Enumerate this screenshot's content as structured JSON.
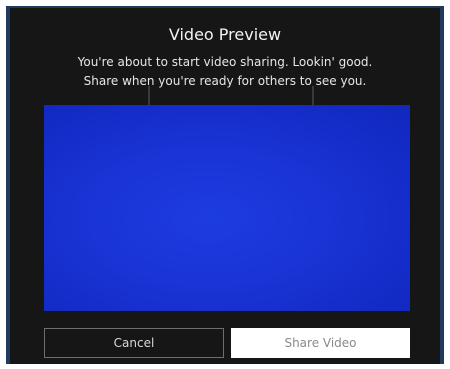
{
  "dialog": {
    "title": "Video Preview",
    "message_line1": "You're about to start video sharing. Lookin' good.",
    "message_line2": "Share when you're ready for others to see you."
  },
  "preview": {
    "feed_color": "#1a34d6"
  },
  "buttons": {
    "cancel_label": "Cancel",
    "share_label": "Share Video"
  }
}
